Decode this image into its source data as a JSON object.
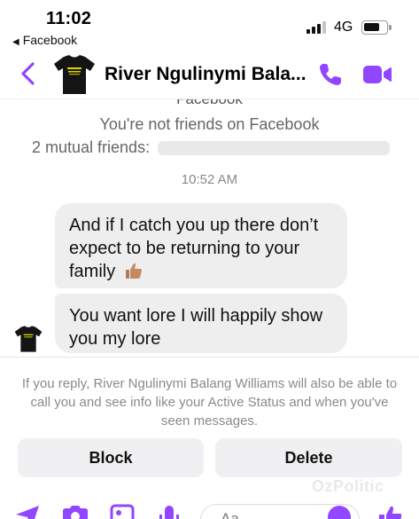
{
  "status_bar": {
    "time": "11:02",
    "back_app": "Facebook",
    "network": "4G"
  },
  "header": {
    "contact_name": "River Ngulinymi Bala...",
    "accent_color": "#9146ff"
  },
  "conversation": {
    "facebook_label": "Facebook",
    "not_friends": "You're not friends on Facebook",
    "mutual_friends": "2 mutual friends:",
    "timestamp": "10:52 AM",
    "messages": [
      {
        "text": "And if I catch you up there don’t expect to be returning to your family",
        "emoji": "thumbs-up"
      },
      {
        "text": "You want lore I will happily show you my lore"
      }
    ]
  },
  "notice": "If you reply, River Ngulinymi Balang Williams will also be able to call you and see info like your Active Status and when you've seen messages.",
  "actions": {
    "block": "Block",
    "delete": "Delete"
  },
  "composer": {
    "placeholder": "Aa"
  },
  "watermark": "OzPolitic"
}
